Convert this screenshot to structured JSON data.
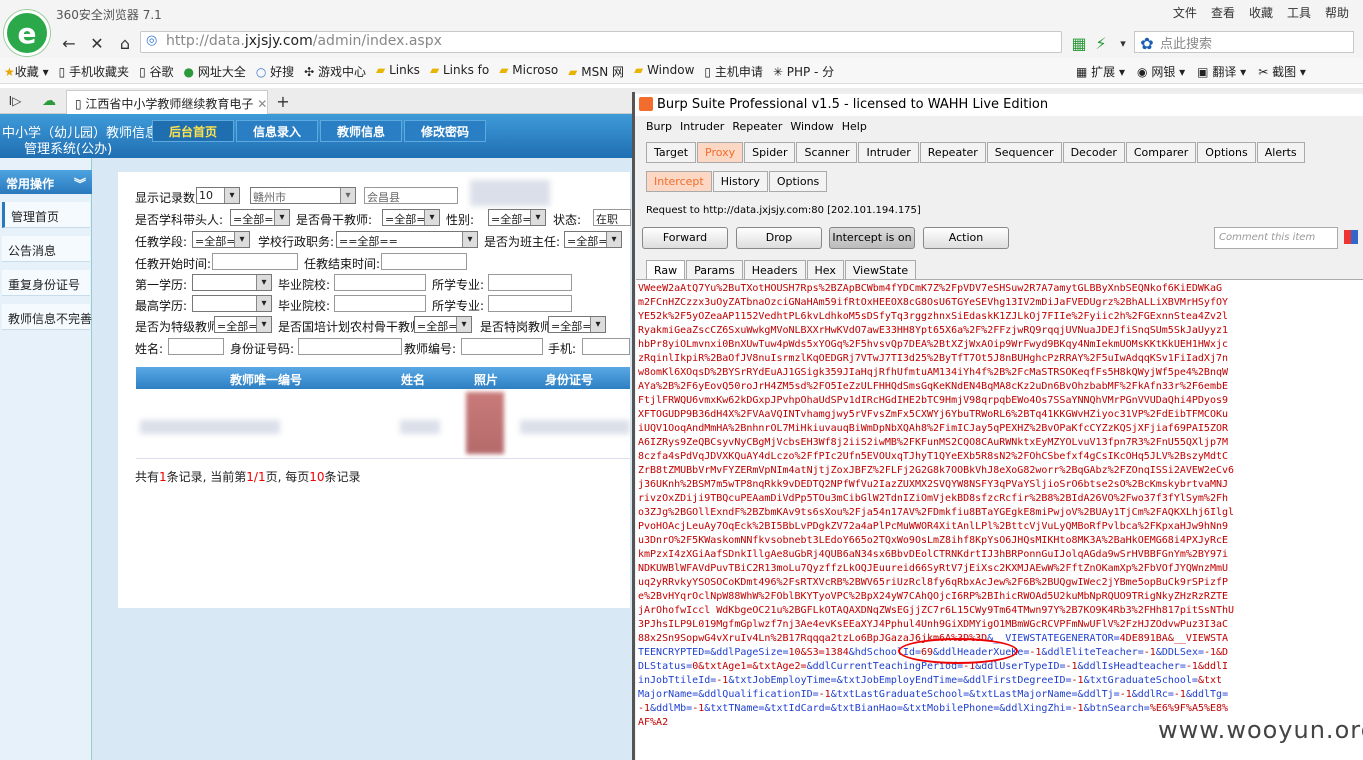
{
  "browser": {
    "brand": "360安全浏览器 7.1",
    "menu": [
      "文件",
      "查看",
      "收藏",
      "工具",
      "帮助"
    ],
    "address_prefix": "http://data.",
    "address_domain": "jxjsjy.com",
    "address_path": "/admin/index.aspx",
    "search_placeholder": "点此搜索",
    "bookmarks": [
      "收藏",
      "手机收藏夹",
      "谷歌",
      "网址大全",
      "好搜",
      "游戏中心",
      "Links",
      "Links fo",
      "Microso",
      "MSN 网",
      "Window",
      "主机申请",
      "PHP - 分"
    ],
    "bookmarks_right": [
      "扩展",
      "网银",
      "翻译",
      "截图"
    ],
    "tab_title": "江西省中小学教师继续教育电子"
  },
  "site": {
    "title_line1": "中小学（幼儿园）教师信息",
    "title_line2": "管理系统(公办)",
    "nav": [
      "后台首页",
      "信息录入",
      "教师信息",
      "修改密码"
    ],
    "sidebar_title": "常用操作",
    "sidebar_items": [
      "管理首页",
      "公告消息",
      "重复身份证号",
      "教师信息不完善"
    ],
    "form": {
      "show_count": "显示记录数:",
      "show_count_value": "10",
      "city": "赣州市",
      "county": "会昌县",
      "subject_leader": "是否学科带头人:",
      "backbone": "是否骨干教师:",
      "gender": "性别:",
      "status": "状态:",
      "status_value": "在职",
      "all": "=全部=",
      "all2": "==全部==",
      "section": "任教学段:",
      "admin_duty": "学校行政职务:",
      "head_teacher": "是否为班主任:",
      "start_time": "任教开始时间:",
      "end_time": "任教结束时间:",
      "first_degree": "第一学历:",
      "grad_school": "毕业院校:",
      "major": "所学专业:",
      "top_degree": "最高学历:",
      "special_teacher": "是否为特级教师",
      "national_training": "是否国培计划农村骨干教师",
      "special_post": "是否特岗教师",
      "name": "姓名:",
      "id_card": "身份证号码:",
      "teacher_no": "教师编号:",
      "phone": "手机:"
    },
    "table_headers": [
      "教师唯一编号",
      "姓名",
      "照片",
      "身份证号"
    ],
    "footer": {
      "p1": "共有",
      "total": "1",
      "p2": "条记录, 当前第",
      "page": "1/1",
      "p3": "页, 每页",
      "per_page": "10",
      "p4": "条记录"
    }
  },
  "burp": {
    "title": "Burp Suite Professional v1.5 - licensed to WAHH Live Edition",
    "menu": [
      "Burp",
      "Intruder",
      "Repeater",
      "Window",
      "Help"
    ],
    "tabs": [
      "Target",
      "Proxy",
      "Spider",
      "Scanner",
      "Intruder",
      "Repeater",
      "Sequencer",
      "Decoder",
      "Comparer",
      "Options",
      "Alerts"
    ],
    "subtabs": [
      "Intercept",
      "History",
      "Options"
    ],
    "request_to": "Request to http://data.jxjsjy.com:80  [202.101.194.175]",
    "buttons": [
      "Forward",
      "Drop",
      "Intercept is on",
      "Action"
    ],
    "comment_placeholder": "Comment this item",
    "view_tabs": [
      "Raw",
      "Params",
      "Headers",
      "Hex",
      "ViewState"
    ],
    "raw_lines": [
      "VWeeW2aAtQ7Yu%2BuTXotHOUSH7Rps%2BZApBCWbm4fYDCmK7Z%2FpVDV7eSHSuw2R7A7amytGLBByXnbSEQNkof6KiEDWKaG",
      "m2FCnHZCzzx3uOyZATbnaOzciGNaHAm59ifRtOxHEEOX8cG8OsU6TGYeSEVhg13IV2mDiJaFVEDUgrz%2BhALLiXBVMrHSyfOY",
      "YE52k%2F5yOZeaAP1152VedhtPL6kvLdhkoM5sDSfyTq3rggzhnxSiEdaskK1ZJLkOj7FIIe%2Fyiic2h%2FGExnnStea4Zv2l",
      "RyakmiGeaZscCZ6SxuWwkgMVoNLBXXrHwKVdO7awE33HH8Ypt65X6a%2F%2FFzjwRQ9rqqjUVNuaJDEJfiSnqSUm5SkJaUyyz1",
      "hbPr8yiOLmvnxi0BnXUwTuw4pWds5xYOGq%2F5hvsvQp7DEA%2BtXZjWxAOip9WrFwyd9BKqy4NmIekmUOMsKKtKkUEH1HWxjc",
      "zRqinlIkpiR%2BaOfJV8nuIsrmzlKqOEDGRj7VTwJ7TI3d25%2ByTfT7Ot5J8nBUHghcPzRRAY%2F5uIwAdqqKSv1FiIadXj7n",
      "w8omKl6XOqsD%2BYSrRYdEuAJ1GSigk359JIaHqjRfhUfmtuAM134iYh4f%2B%2FcMaSTRSOKeqfFs5H8kQWyjWf5pe4%2BnqW",
      "AYa%2B%2F6yEovQ50roJrH4ZM5sd%2FO5IeZzULFHHQdSmsGqKeKNdEN4BqMA8cKz2uDn6BvOhzbabMF%2FkAfn33r%2F6embE",
      "FtjlFRWQU6vmxKw62kDGxpJPvhpOhaUdSPv1dIRcHGdIHE2bTC9HmjV98qrpqbEWo4Os7SSaYNNQhVMrPGnVVUDaQhi4PDyos9",
      "XFTOGUDP9B36dH4X%2FVAaVQINTvhamgjwy5rVFvsZmFx5CXWYj6YbuTRWoRL6%2BTq41KKGWvHZiyoc31VP%2FdEibTFMCOKu",
      "iUQV1OoqAndMmHA%2BnhnrOL7MiHkiuvauqBiWmDpNbXQAh8%2FimICJay5qPEXHZ%2BvOPaKfcCYZzKQSjXFjiaf69PAI5ZOR",
      "A6IZRys9ZeQBCsyvNyCBgMjVcbsEH3Wf8j2iiS2iwMB%2FKFunMS2CQO8CAuRWNktxEyMZYOLvuV13fpn7R3%2FnU55QXljp7M",
      "8czfa4sPdVqJDVXKQuAY4dLczo%2FfPIc2Ufn5EVOUxqTJhyT1QYeEXb5R8sN2%2FOhCSbefxf4gCsIKcOHq5JLV%2BszyMdtC",
      "ZrB8tZMUBbVrMvFYZERmVpNIm4atNjtjZoxJBFZ%2FLFj2G2G8k7OOBkVhJ8eXoG82worr%2BqGAbz%2FZOnqISSi2AVEW2eCv6",
      "j36UKnh%2BSM7m5wTP8nqRkk9vDEDTQ2NPfWfVu2IazZUXMX2SVQYW8NSFY3qPVaYSljioSrO6btse2sO%2BcKmskybrtvaMNJ",
      "rivzOxZDiji9TBQcuPEAamDiVdPp5TOu3mCibGlW2TdnIZiOmVjekBD8sfzcRcfir%2B8%2BIdA26VO%2Fwo37f3fYlSym%2Fh",
      "o3ZJg%2BGOllExndF%2BZbmKAv9ts6sXou%2Fja54n17AV%2FDmkfiu8BTaYGEgkE8miPwjoV%2BUAy1TjCm%2FAQKXLhj6Ilgl",
      "PvoHOAcjLeuAy7OqEck%2BI5BbLvPDgkZV72a4aPlPcMuWWOR4XitAnlLPl%2BttcVjVuLyQMBoRfPvlbca%2FKpxaHJw9hNn9",
      "u3DnrO%2F5KWaskomNNfkvsobnebt3LEdoY665o2TQxWo9OsLmZ8ihf8KpYsO6JHQsMIKHto8MK3A%2BaHkOEMG68i4PXJyRcE",
      "kmPzxI4zXGiAafSDnkIllgAe8uGbRj4QUB6aN34sx6BbvDEolCTRNKdrtIJ3hBRPonnGuIJolqAGda9wSrHVBBFGnYm%2BY97i",
      "NDKUWBlWFAVdPuvTBiC2R13moLu7QyzffzLkOQJEuureid66SyRtV7jEiXsc2KXMJAEwW%2FftZnOKamXp%2FbVOfJYQWnzMmU",
      "uq2yRRvkyYSOSOCoKDmt496%2FsRTXVcRB%2BWV65riUzRcl8fy6qRbxAcJew%2F6B%2BUQgwIWec2jYBme5opBuCk9rSPizfP",
      "e%2BvHYqrOclNpW88WhW%2FOblBKYTyoVPC%2BpX24yW7CAhQOjcI6RP%2BIhicRWOAd5U2kuMbNpRQUO9TRigNkyZHzRzRZTE",
      "jArOhofwIccl WdKbgeOC21u%2BGFLkOTAQAXDNqZWsEGjjZC7r6L15CWy9Tm64TMwn97Y%2B7KO9K4Rb3%2FHh817pitSsNThU",
      "3PJhsILP9L019MgfmGplwzf7nj3Ae4evKsEEaXYJ4Pphul4Unh9GiXDMYigO1MBmWGcRCVPFmNwUFlV%2FzHJZOdvwPuz3I3aC",
      "88x2Sn9SopwG4vXruIv4Ln%2B17Rqqqa2tzLo6BpJGazaJ6jkm6A%3D%3D&__VIEWSTATEGENERATOR=4DE891BA&__VIEWSTA",
      "TEENCRYPTED=&ddlPageSize=10&S3=1384&hdSchoolId=69&ddlHeaderXueKe=-1&ddlEliteTeacher=-1&DDLSex=-1&D",
      "DLStatus=0&txtAge1=&txtAge2=&ddlCurrentTeachingPeriod=-1&ddlUserTypeID=-1&ddlIsHeadteacher=-1&ddlI",
      "inJobTtileId=-1&txtJobEmployTime=&txtJobEmployEndTime=&ddlFirstDegreeID=-1&txtGraduateSchool=&txt",
      "MajorName=&ddlQualificationID=-1&txtLastGraduateSchool=&txtLastMajorName=&ddlTj=-1&ddlRc=-1&ddlTg=",
      "-1&ddlMb=-1&txtTName=&txtIdCard=&txtBianHao=&txtMobilePhone=&ddlXingZhi=-1&btnSearch=%E6%9F%A5%E8%",
      "AF%A2"
    ]
  },
  "watermark": "www.wooyun.org"
}
